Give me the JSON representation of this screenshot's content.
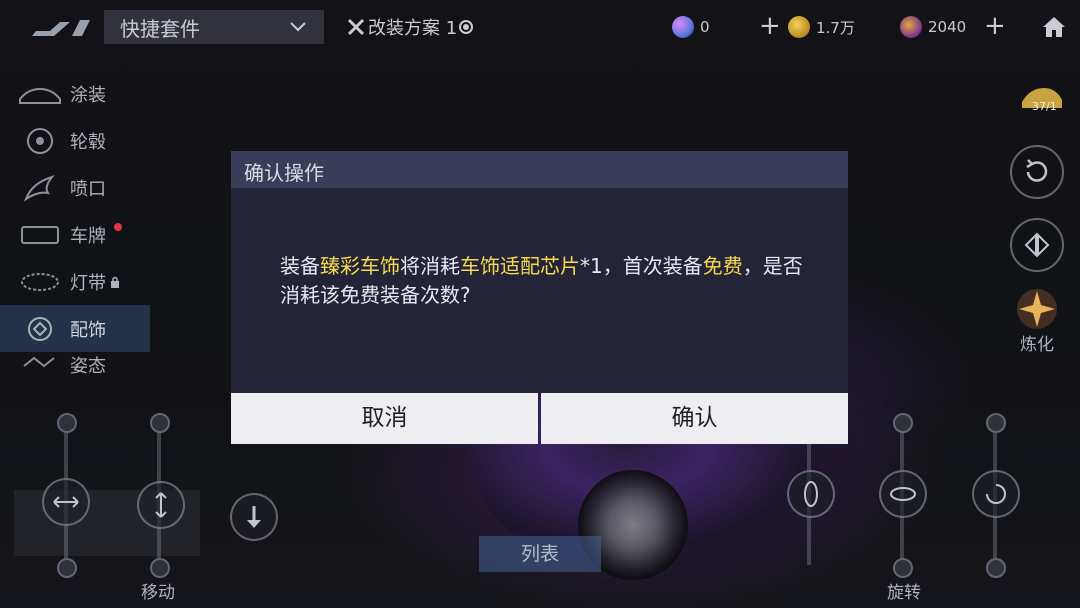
{
  "topbar": {
    "preset_label": "快捷套件",
    "plan_label": "改装方案 1",
    "currency_a": "0",
    "currency_b": "1.7万",
    "currency_c": "2040"
  },
  "menu": {
    "items": [
      {
        "label": "涂装"
      },
      {
        "label": "轮毂"
      },
      {
        "label": "喷口"
      },
      {
        "label": "车牌"
      },
      {
        "label": "灯带"
      },
      {
        "label": "配饰"
      },
      {
        "label": "姿态"
      }
    ],
    "active_index": 5
  },
  "right_tools": {
    "garage_badge": "37/1",
    "refine_label": "炼化"
  },
  "bottom": {
    "move_label": "移动",
    "list_label": "列表",
    "rotate_label": "旋转"
  },
  "dialog": {
    "title": "确认操作",
    "msg_1": "装备",
    "msg_2": "臻彩车饰",
    "msg_3": "将消耗",
    "msg_4": "车饰适配芯片",
    "msg_5": "*1，首次装备",
    "msg_6": "免费",
    "msg_7": "，是否消耗该免费装备次数?",
    "cancel_label": "取消",
    "confirm_label": "确认"
  },
  "colors": {
    "highlight": "#f6d94c",
    "dialog_header": "#3a3d5a",
    "dialog_body": "#232438",
    "menu_active": "#466eaa",
    "badge_red": "#e2334b"
  },
  "icons": [
    "logo-icon",
    "chevron-down-icon",
    "wrench-icon",
    "gem-icon",
    "star-coin-icon",
    "purple-coin-icon",
    "home-icon",
    "rotate-icon",
    "mirror-icon",
    "spark-icon",
    "move-arrows-icon",
    "up-down-icon",
    "down-arrow-icon",
    "rotate-x-icon",
    "rotate-y-icon",
    "rotate-z-icon"
  ]
}
